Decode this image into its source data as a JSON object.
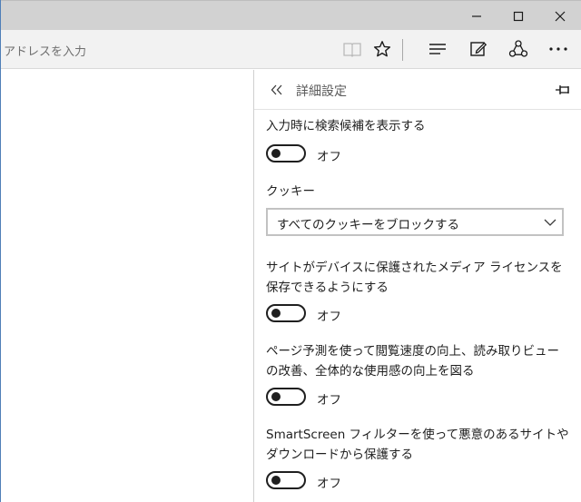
{
  "window": {
    "controls": [
      "minimize",
      "maximize",
      "close"
    ]
  },
  "toolbar": {
    "address_placeholder": "アドレスを入力",
    "icons": [
      "reading-view-icon",
      "favorite-star-icon",
      "hub-icon",
      "web-note-icon",
      "share-icon",
      "more-icon"
    ]
  },
  "panel": {
    "title": "詳細設定",
    "settings": [
      {
        "label": "入力時に検索候補を表示する",
        "state": "オフ"
      },
      {
        "label": "クッキー",
        "selected": "すべてのクッキーをブロックする"
      },
      {
        "label": "サイトがデバイスに保護されたメディア ライセンスを保存できるようにする",
        "state": "オフ"
      },
      {
        "label": "ページ予測を使って閲覧速度の向上、読み取りビューの改善、全体的な使用感の向上を図る",
        "state": "オフ"
      },
      {
        "label": "SmartScreen フィルターを使って悪意のあるサイトやダウンロードから保護する",
        "state": "オフ"
      }
    ]
  }
}
